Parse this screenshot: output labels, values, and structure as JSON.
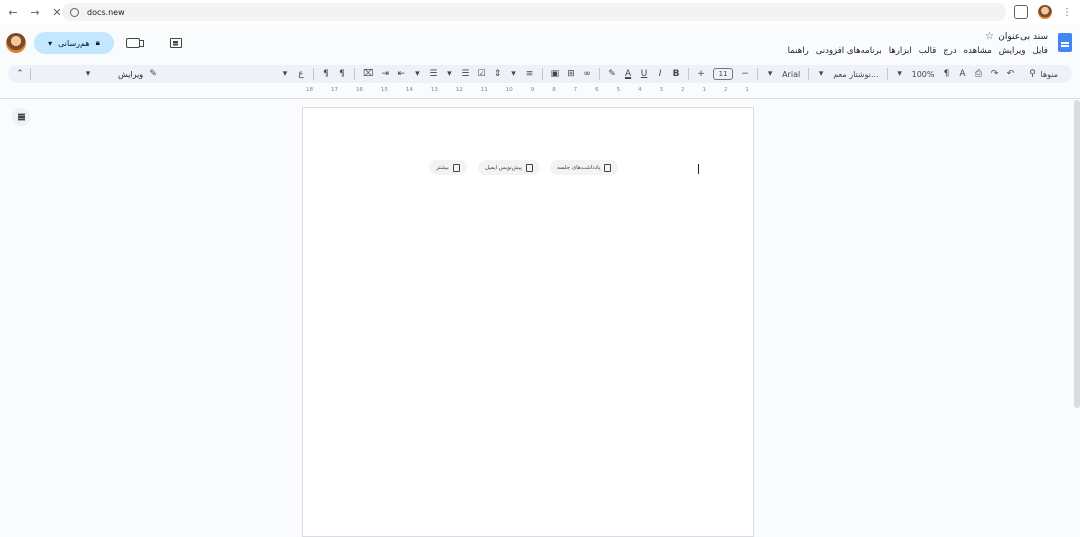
{
  "browser": {
    "url": "docs.new"
  },
  "doc": {
    "title": "سند بی‌عنوان",
    "menu": [
      "فایل",
      "ویرایش",
      "مشاهده",
      "درج",
      "قالب",
      "ابزارها",
      "برنامه‌های افزودنی",
      "راهنما"
    ],
    "share_label": "هم‌رسانی"
  },
  "toolbar": {
    "search_label": "منوها",
    "zoom": "100%",
    "style": "نوشتار معم...",
    "font": "Arial",
    "font_size": "11",
    "edit_mode": "ویرایش"
  },
  "ruler": {
    "marks": [
      "1",
      "2",
      "1",
      "2",
      "3",
      "4",
      "5",
      "6",
      "7",
      "8",
      "9",
      "10",
      "11",
      "12",
      "13",
      "14",
      "15",
      "16",
      "17",
      "18"
    ]
  },
  "chips": {
    "meeting_notes": "یادداشت‌های جلسه",
    "email_draft": "پیش‌نویس ایمیل",
    "more": "بیشتر"
  },
  "colors": {
    "accent": "#c2e7ff",
    "toolbar_bg": "#edf2fa",
    "docs_blue": "#4285f4"
  }
}
